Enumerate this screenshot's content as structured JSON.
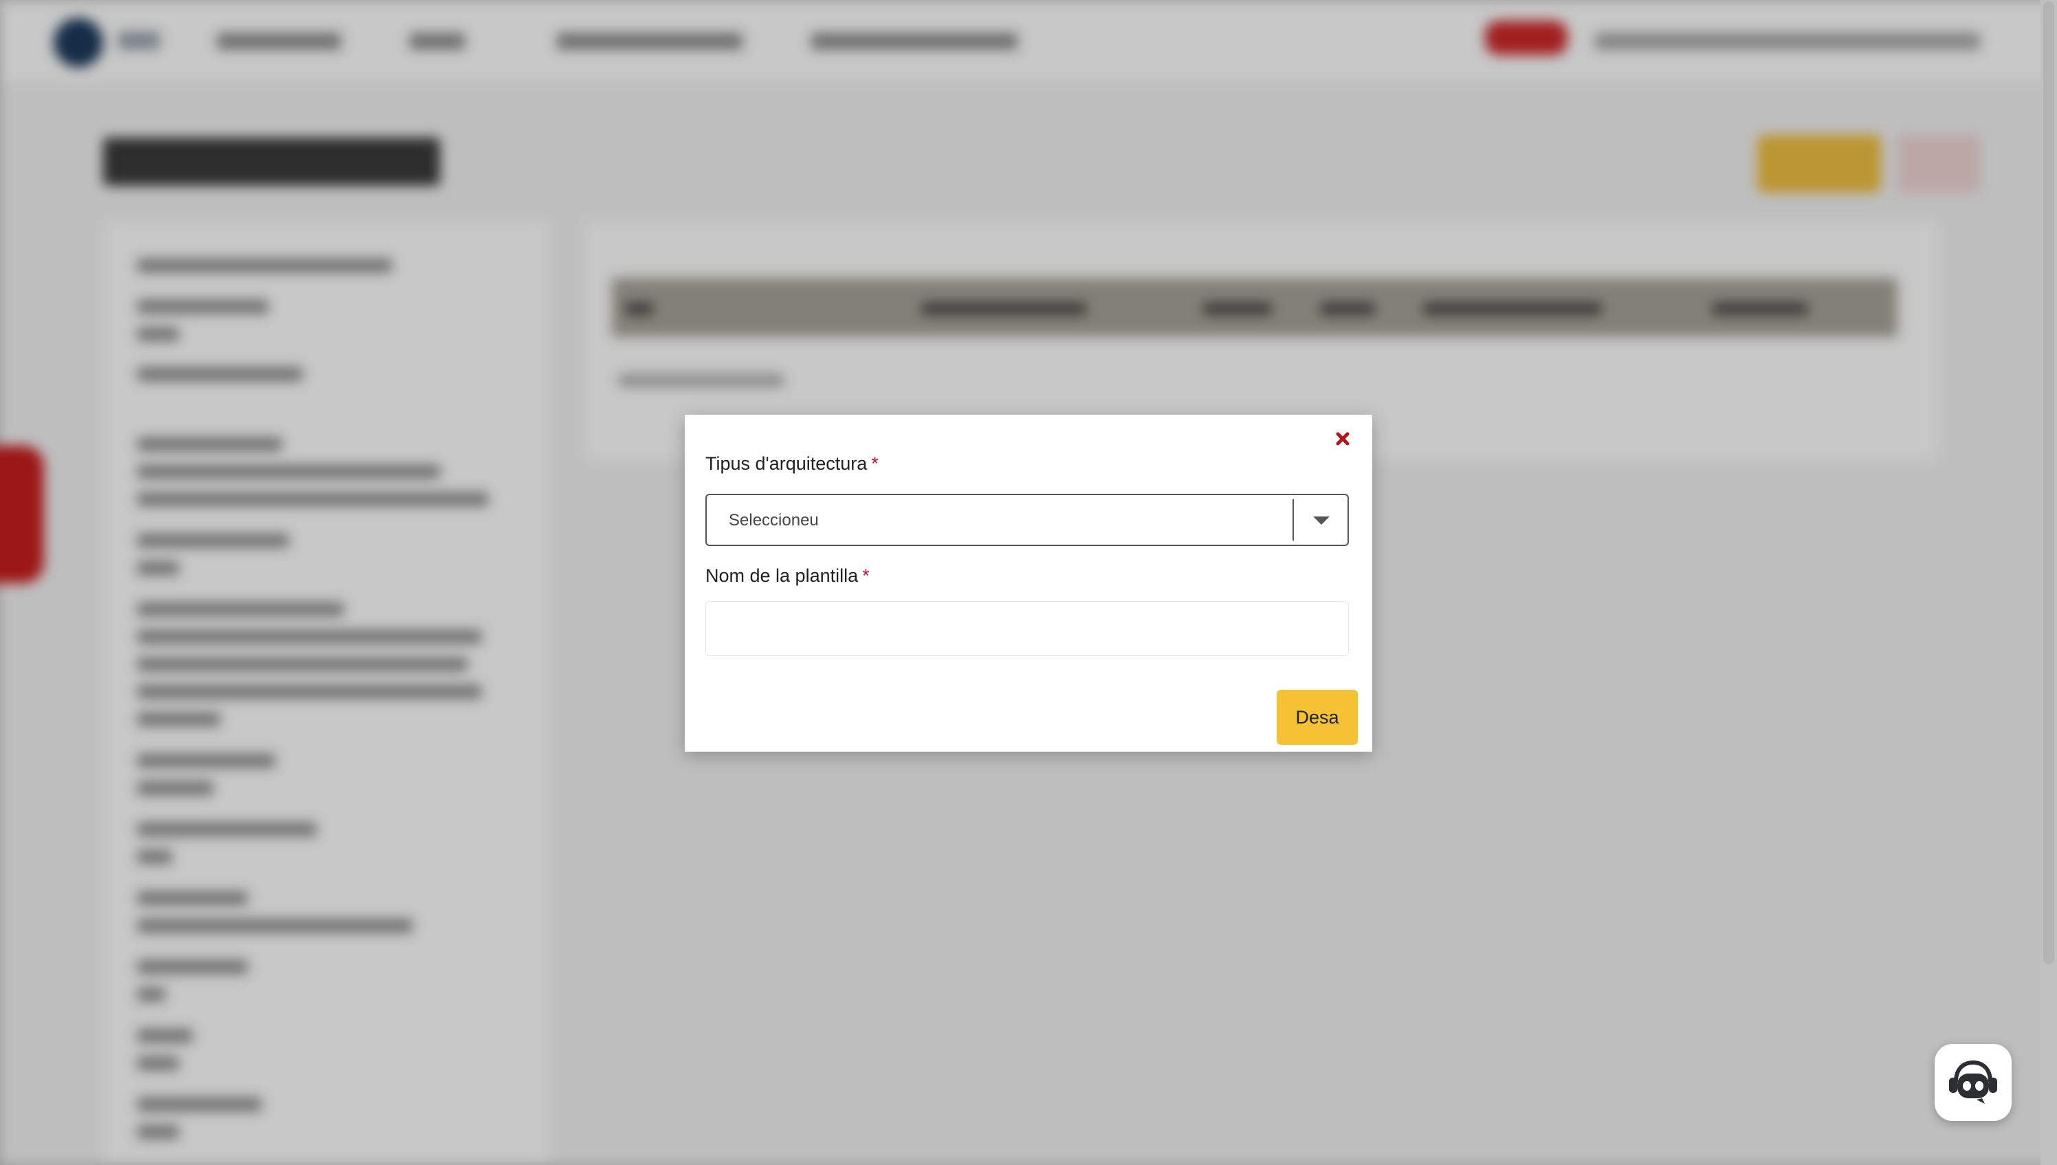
{
  "modal": {
    "architecture_label": "Tipus d'arquitectura",
    "architecture_required": "*",
    "architecture_select_value": "Seleccioneu",
    "template_name_label": "Nom de la plantilla",
    "template_name_required": "*",
    "template_name_value": "",
    "save_label": "Desa",
    "close_icon": "close-x-icon"
  },
  "chatbot": {
    "icon": "robot-icon"
  },
  "colors": {
    "accent": "#f4c232",
    "required": "#c8102e",
    "close": "#b3151b"
  }
}
